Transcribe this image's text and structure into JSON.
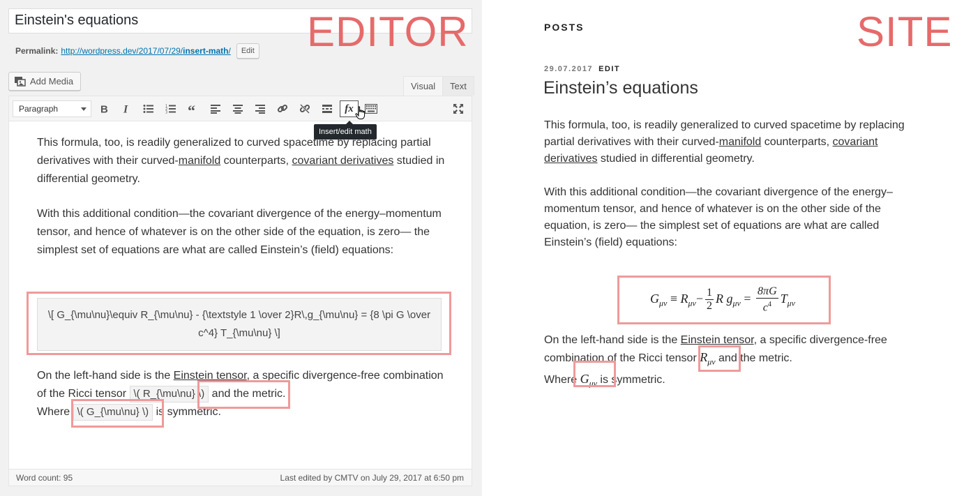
{
  "labels": {
    "editor": "EDITOR",
    "site": "SITE"
  },
  "editor": {
    "title_value": "Einstein's equations",
    "permalink": {
      "label": "Permalink:",
      "url_prefix": "http://wordpress.dev/2017/07/29/",
      "url_slug": "insert-math",
      "url_suffix": "/",
      "edit_button": "Edit"
    },
    "add_media": "Add Media",
    "tabs": {
      "visual": "Visual",
      "text": "Text"
    },
    "toolbar": {
      "format_select": "Paragraph",
      "buttons": [
        "bold-icon",
        "italic-icon",
        "bulleted-list-icon",
        "numbered-list-icon",
        "blockquote-icon",
        "align-left-icon",
        "align-center-icon",
        "align-right-icon",
        "link-icon",
        "unlink-icon",
        "read-more-icon",
        "math-fx-icon",
        "keyboard-icon",
        "fullscreen-icon"
      ],
      "fx_label": "fx",
      "tooltip": "Insert/edit math"
    },
    "content": {
      "p1_a": "This formula, too, is readily generalized to curved spacetime by replacing partial derivatives with their curved-",
      "p1_link1": "manifold",
      "p1_b": " counterparts, ",
      "p1_link2": "covariant derivatives",
      "p1_c": " studied in differential geometry.",
      "p2": "With this additional condition—the covariant divergence of the energy–momentum tensor, and hence of whatever is on the other side of the equation, is zero— the simplest set of equations are what are called Einstein’s (field) equations:",
      "latex_block": "\\[ G_{\\mu\\nu}\\equiv R_{\\mu\\nu} - {\\textstyle 1 \\over 2}R\\,g_{\\mu\\nu} = {8 \\pi G \\over c^4} T_{\\mu\\nu} \\]",
      "p3_a": "On the left-hand side is the ",
      "p3_link": "Einstein tensor",
      "p3_b": ", a specific divergence-free combination of the Ricci tensor ",
      "p3_latex1": "\\( R_{\\mu\\nu} \\)",
      "p3_c": " and the metric.",
      "p4_a": "Where ",
      "p4_latex": "\\( G_{\\mu\\nu} \\)",
      "p4_b": " is symmetric."
    },
    "status": {
      "word_count": "Word count: 95",
      "last_edited": "Last edited by CMTV on July 29, 2017 at 6:50 pm"
    }
  },
  "site": {
    "heading": "POSTS",
    "date": "29.07.2017",
    "edit": "EDIT",
    "title": "Einstein’s equations",
    "p1_a": "This formula, too, is readily generalized to curved spacetime by replacing partial derivatives with their curved-",
    "p1_link1": "manifold",
    "p1_b": " counterparts, ",
    "p1_link2": "covariant derivatives",
    "p1_c": " studied in differential geometry.",
    "p2": "With this additional condition—the covariant divergence of the energy–momentum tensor, and hence of whatever is on the other side of the equation, is zero— the simplest set of equations are what are called Einstein’s (field) equations:",
    "p3_a": "On the left-hand side is the ",
    "p3_link": "Einstein tensor",
    "p3_b": ", a specific divergence-free combination of the Ricci tensor ",
    "p3_c": " and the metric.",
    "p4_a": "Where ",
    "p4_b": " is symmetric.",
    "math": {
      "G": "G",
      "R": "R",
      "g": "g",
      "T": "T",
      "munu": "μν",
      "equiv": "≡",
      "minus": "−",
      "equals": "=",
      "half_num": "1",
      "half_den": "2",
      "frac_num": "8πG",
      "frac_den_base": "c",
      "frac_den_exp": "4"
    }
  }
}
